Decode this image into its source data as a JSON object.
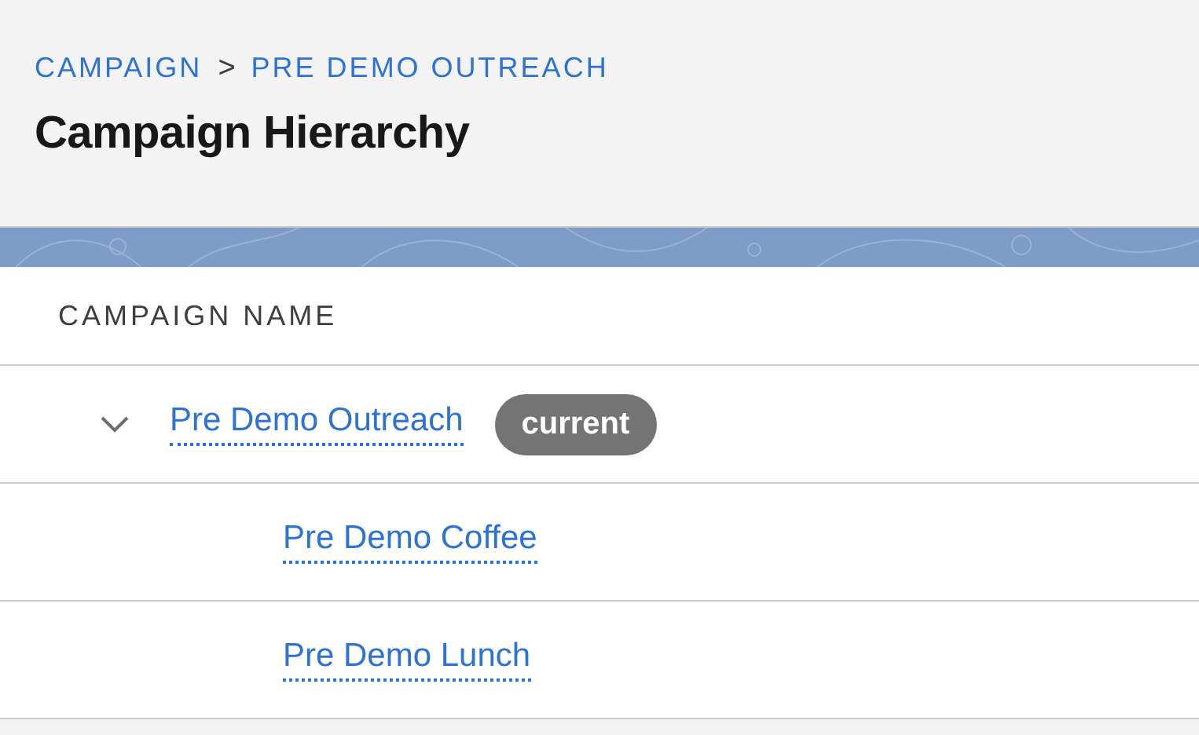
{
  "breadcrumb": {
    "items": [
      "CAMPAIGN",
      "PRE DEMO OUTREACH"
    ],
    "separator": ">"
  },
  "title": "Campaign Hierarchy",
  "table": {
    "columns": [
      "CAMPAIGN NAME"
    ],
    "rows": [
      {
        "name": "Pre Demo Outreach",
        "badge": "current",
        "expanded": true,
        "children": [
          {
            "name": "Pre Demo Coffee"
          },
          {
            "name": "Pre Demo Lunch"
          }
        ]
      }
    ]
  }
}
